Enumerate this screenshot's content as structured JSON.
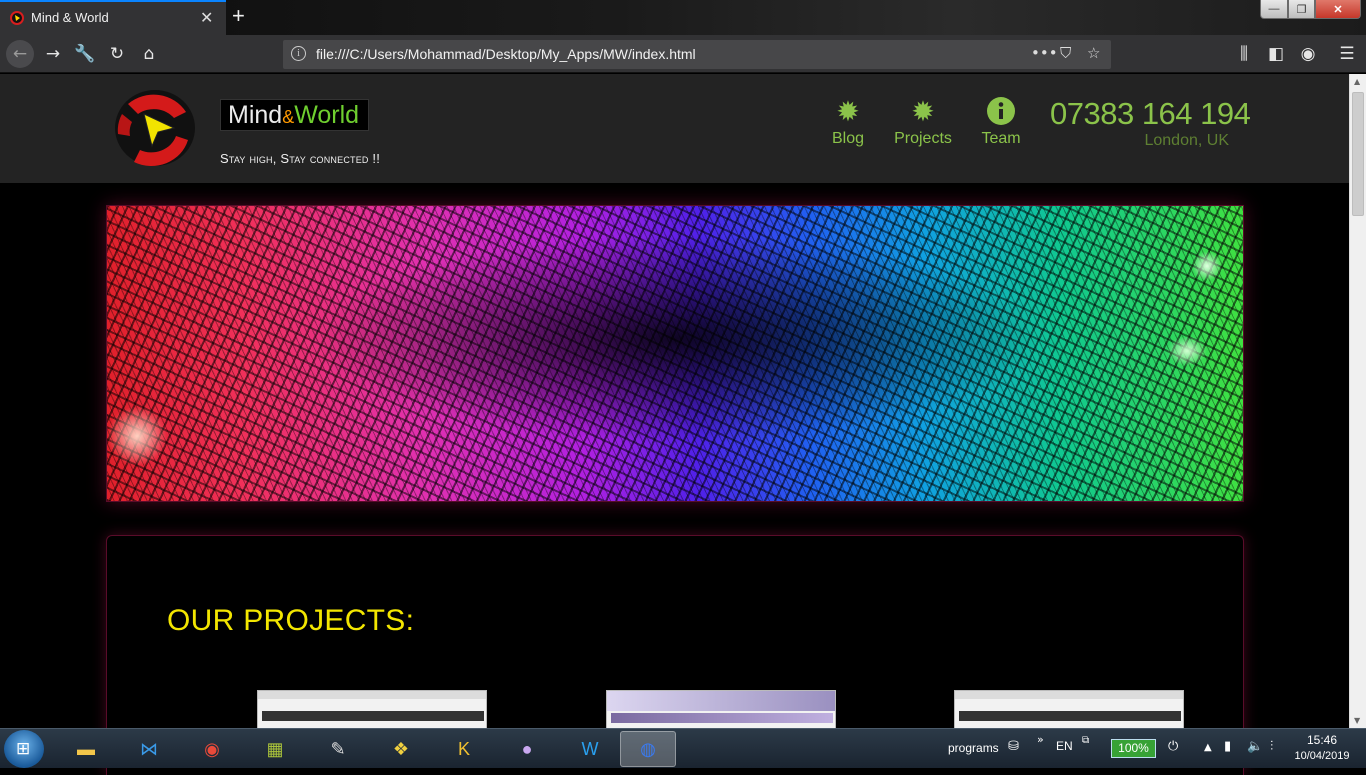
{
  "browser": {
    "tab_title": "Mind & World",
    "tab_close": "✕",
    "new_tab": "+",
    "url": "file:///C:/Users/Mohammad/Desktop/My_Apps/MW/index.html",
    "window_controls": {
      "minimize": "—",
      "maximize": "❐",
      "close": "✕"
    }
  },
  "site": {
    "brand_part1": "Mind",
    "brand_amp": "&",
    "brand_part2": "World",
    "tagline": "Stay high, Stay connected !!",
    "nav": [
      {
        "label": "Blog",
        "icon": "sunburst-icon"
      },
      {
        "label": "Projects",
        "icon": "sunburst-icon"
      },
      {
        "label": "Team",
        "icon": "info-icon"
      }
    ],
    "phone": "07383 164 194",
    "location": "London, UK",
    "projects_heading": "OUR PROJECTS:",
    "accent_color": "#8bc34a",
    "heading_color": "#f3e600"
  },
  "taskbar": {
    "programs_label": "programs",
    "language": "EN",
    "battery": "100%",
    "time": "15:46",
    "date": "10/04/2019"
  }
}
